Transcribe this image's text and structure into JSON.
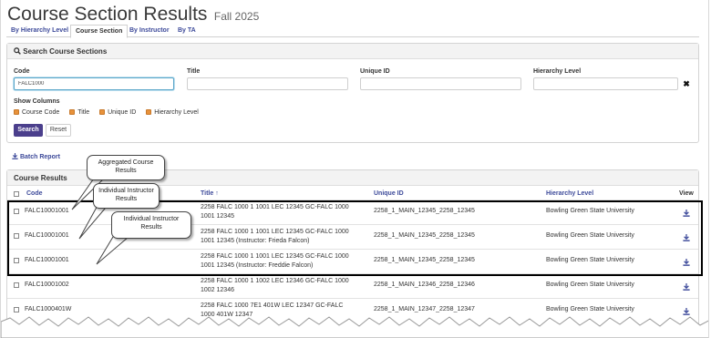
{
  "header": {
    "title": "Course Section Results",
    "term": "Fall 2025"
  },
  "tabs": [
    {
      "label": "By Hierarchy Level",
      "active": false
    },
    {
      "label": "Course Section",
      "active": true
    },
    {
      "label": "By Instructor",
      "active": false
    },
    {
      "label": "By TA",
      "active": false
    }
  ],
  "search": {
    "heading": "Search Course Sections",
    "code_label": "Code",
    "code_value": "FALC1000",
    "title_label": "Title",
    "title_value": "",
    "uid_label": "Unique ID",
    "uid_value": "",
    "hierarchy_label": "Hierarchy Level",
    "hierarchy_value": "",
    "clear_glyph": "✖",
    "show_columns_label": "Show Columns",
    "columns": [
      "Course Code",
      "Title",
      "Unique ID",
      "Hierarchy Level"
    ],
    "search_button": "Search",
    "reset_button": "Reset"
  },
  "batch_report": "Batch Report",
  "results": {
    "heading": "Course Results",
    "headers": {
      "code": "Code",
      "title": "Title ↑",
      "uid": "Unique ID",
      "hierarchy": "Hierarchy Level",
      "view": "View"
    },
    "rows": [
      {
        "code": "FALC10001001",
        "title": "2258 FALC 1000 1 1001 LEC 12345 GC-FALC 1000 1001 12345",
        "uid": "2258_1_MAIN_12345_2258_12345",
        "hierarchy": "Bowling Green State University"
      },
      {
        "code": "FALC10001001",
        "title": "2258 FALC 1000 1 1001 LEC 12345 GC-FALC 1000 1001 12345 (Instructor: Frieda Falcon)",
        "uid": "2258_1_MAIN_12345_2258_12345",
        "hierarchy": "Bowling Green State University"
      },
      {
        "code": "FALC10001001",
        "title": "2258 FALC 1000 1 1001 LEC 12345 GC-FALC 1000 1001 12345 (Instructor: Freddie Falcon)",
        "uid": "2258_1_MAIN_12345_2258_12345",
        "hierarchy": "Bowling Green State University"
      },
      {
        "code": "FALC10001002",
        "title": "2258 FALC 1000 1 1002 LEC 12346 GC-FALC 1000 1002 12346",
        "uid": "2258_1_MAIN_12346_2258_12346",
        "hierarchy": "Bowling Green State University"
      },
      {
        "code": "FALC1000401W",
        "title": "2258 FALC 1000 7E1 401W LEC 12347 GC-FALC 1000 401W 12347",
        "uid": "2258_1_MAIN_12347_2258_12347",
        "hierarchy": "Bowling Green State University"
      }
    ]
  },
  "callouts": {
    "aggregated": "Aggregated Course Results",
    "individual_1": "Individual Instructor Results",
    "individual_2": "Individual Instructor Results"
  },
  "colors": {
    "accent": "#4b3f8c",
    "link": "#3d4a9a",
    "checkbox": "#e8923b",
    "focus": "#5aa6c9"
  }
}
